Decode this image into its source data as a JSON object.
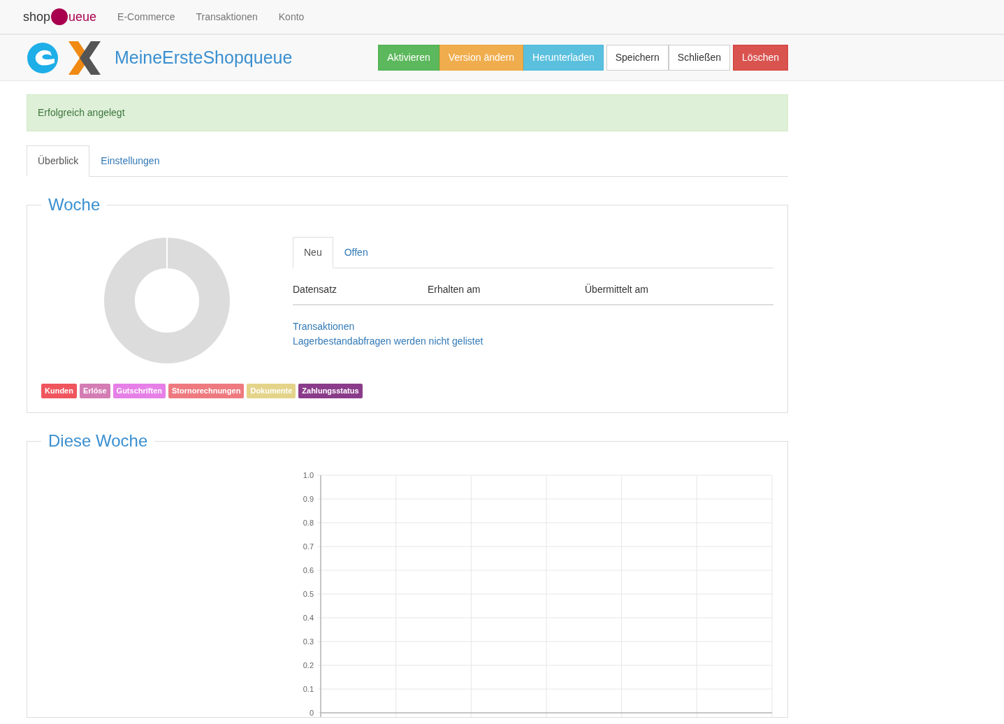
{
  "navbar": {
    "logo": {
      "left": "shop",
      "right": "ueue"
    },
    "links": [
      {
        "label": "E-Commerce"
      },
      {
        "label": "Transaktionen"
      },
      {
        "label": "Konto"
      }
    ]
  },
  "header": {
    "title": "MeineErsteShopqueue",
    "buttons": [
      {
        "label": "Aktivieren",
        "kind": "success"
      },
      {
        "label": "Version ändern",
        "kind": "warning"
      },
      {
        "label": "Herunterladen",
        "kind": "info"
      },
      {
        "label": "Speichern",
        "kind": "default"
      },
      {
        "label": "Schließen",
        "kind": "default"
      },
      {
        "label": "Löschen",
        "kind": "danger"
      }
    ]
  },
  "alert": "Erfolgreich angelegt",
  "tabs": [
    {
      "label": "Überblick",
      "selected": true
    },
    {
      "label": "Einstellungen",
      "selected": false
    }
  ],
  "week": {
    "title": "Woche",
    "legend": [
      {
        "label": "Kunden",
        "color": "#f0555e"
      },
      {
        "label": "Erlöse",
        "color": "#d47cb4"
      },
      {
        "label": "Gutschriften",
        "color": "#e680e8"
      },
      {
        "label": "Stornorechnungen",
        "color": "#ee7a80"
      },
      {
        "label": "Dokumente",
        "color": "#e4d48a"
      },
      {
        "label": "Zahlungsstatus",
        "color": "#8a3c8a"
      }
    ],
    "subtabs": [
      {
        "label": "Neu",
        "selected": true
      },
      {
        "label": "Offen",
        "selected": false
      }
    ],
    "columns": [
      "Datensatz",
      "Erhalten am",
      "Übermittelt am"
    ],
    "link": "Transaktionen",
    "note": "Lagerbestandabfragen werden nicht gelistet"
  },
  "this_week": {
    "title": "Diese Woche",
    "chart_data": {
      "type": "line",
      "grid": true,
      "categories": [
        null,
        null,
        null,
        null,
        null,
        null,
        null
      ],
      "values": [
        null,
        null,
        null,
        null,
        null,
        null,
        null
      ],
      "ylim": [
        0,
        1
      ],
      "yticks": [
        0,
        0.1,
        0.2,
        0.3,
        0.4,
        0.5,
        0.6,
        0.7,
        0.8,
        0.9,
        {
          "value": 1,
          "label": "1.0"
        }
      ]
    }
  }
}
